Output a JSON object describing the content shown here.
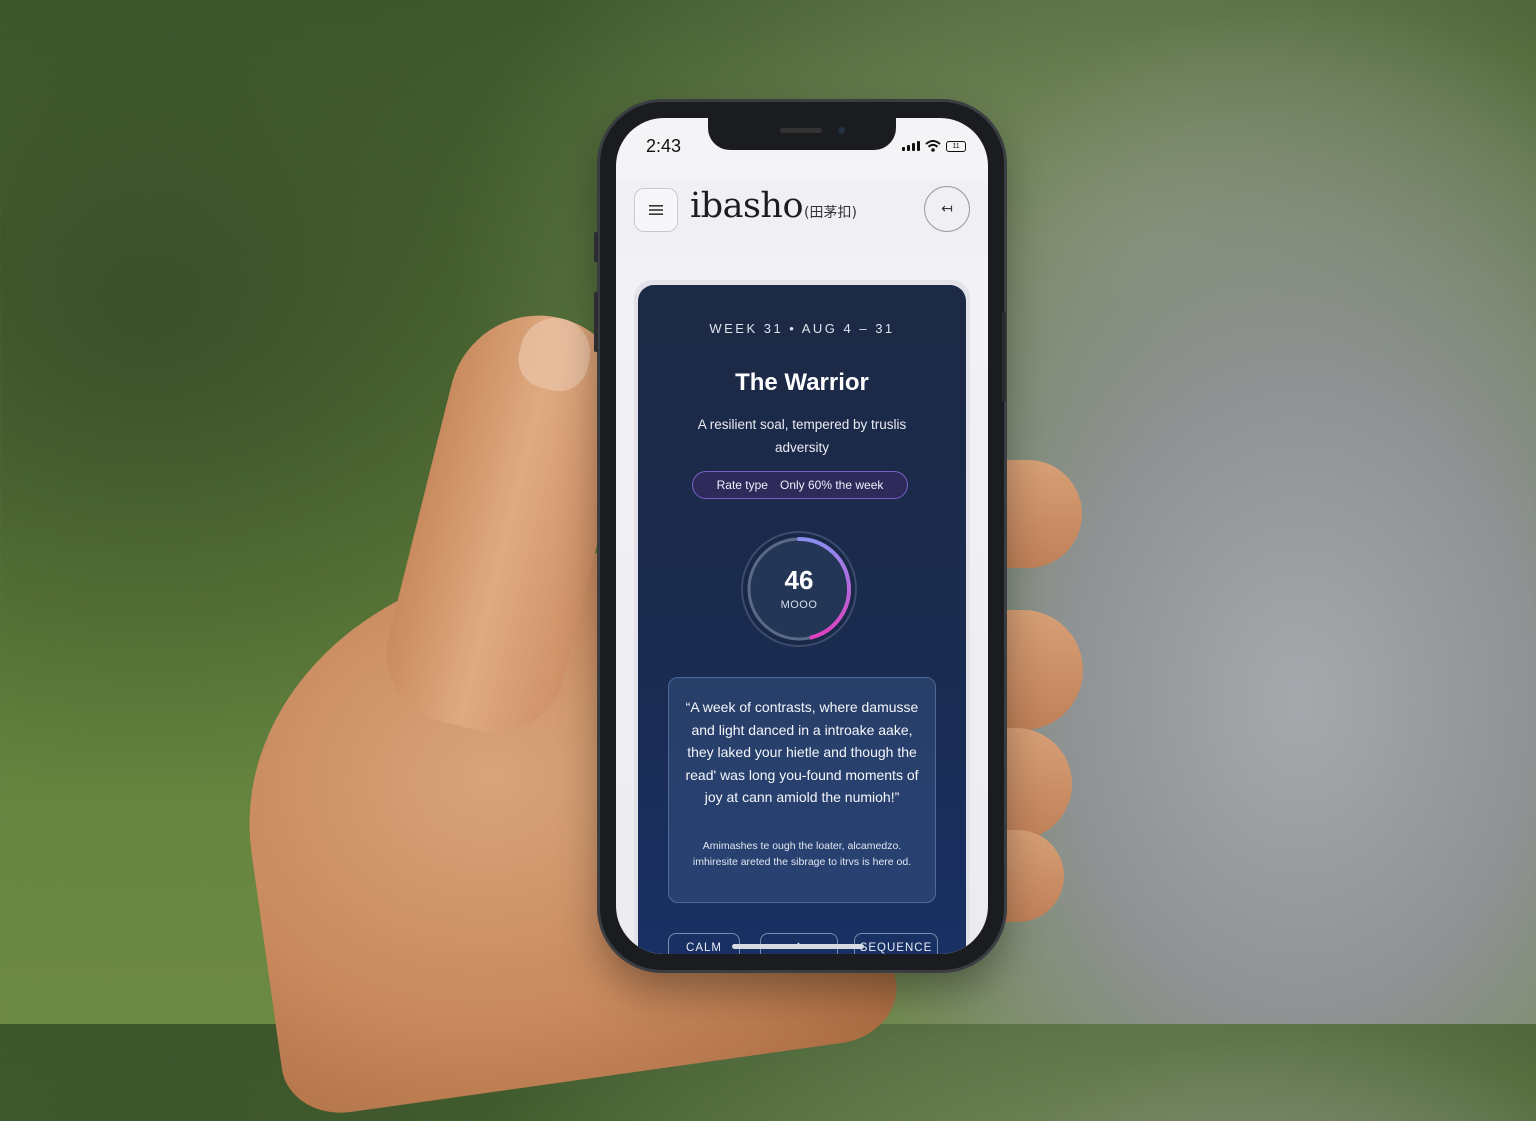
{
  "status_bar": {
    "time": "2:43",
    "battery": "11"
  },
  "header": {
    "menu_icon": "hamburger-icon",
    "brand": "ibasho",
    "brand_sub": "(田茅扣)",
    "logout_icon": "logout-arrow-icon",
    "logout_glyph": "↤"
  },
  "card": {
    "week_label": "WEEK 31 • AUG 4 – 31",
    "title": "The Warrior",
    "subtitle": "A resilient soal, tempered by truslis adversity",
    "pill": {
      "label": "Rate type",
      "value": "Only 60% the week"
    },
    "gauge": {
      "value": "46",
      "label": "MOOO",
      "fill_fraction": 0.46,
      "colors": [
        "#8a8ef0",
        "#e040c0"
      ]
    },
    "quote": "“A week of contrasts, where damusse and light danced in a introake aake, they laked your hietle and though the read' was long you-found moments of joy at cann amiold the numioh!”",
    "note": "Amimashes te ough the loater, alcamedzo. imhiresite areted the sibrage to itrvs is here od.",
    "chips": [
      "CALM",
      "^",
      "SEQUENCE"
    ]
  },
  "colors": {
    "card_top": "#1d2a45",
    "card_bottom": "#183064",
    "pill_border": "#7a5fc8"
  }
}
